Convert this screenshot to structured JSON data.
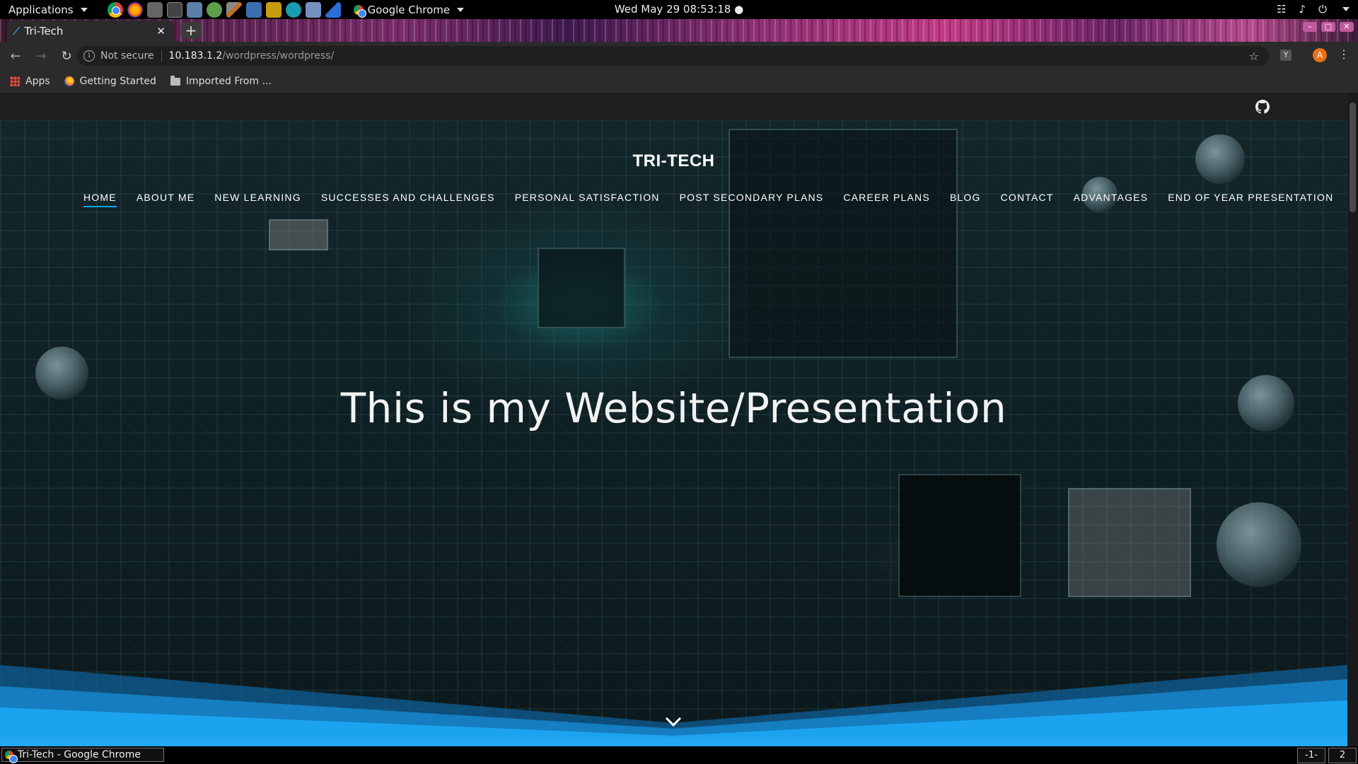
{
  "panel": {
    "applications_label": "Applications",
    "active_app": "Google Chrome",
    "clock": "Wed May 29  08:53:18 ●"
  },
  "tab": {
    "title": "Tri-Tech",
    "close": "✕",
    "new_tab": "+"
  },
  "toolbar": {
    "back": "←",
    "forward": "→",
    "reload": "↻",
    "not_secure": "Not secure",
    "url_host": "10.183.1.2",
    "url_path": "/wordpress/wordpress/",
    "star": "☆",
    "ext_label": "Y",
    "avatar_letter": "A",
    "menu": "⋮"
  },
  "bookmarks": [
    {
      "label": "Apps",
      "icon": "apps-grid-icon"
    },
    {
      "label": "Getting Started",
      "icon": "firefox-icon"
    },
    {
      "label": "Imported From ...",
      "icon": "folder-icon"
    }
  ],
  "site": {
    "title": "TRI-TECH",
    "nav": [
      {
        "label": "HOME",
        "active": true
      },
      {
        "label": "ABOUT ME",
        "active": false
      },
      {
        "label": "NEW LEARNING",
        "active": false
      },
      {
        "label": "SUCCESSES AND CHALLENGES",
        "active": false
      },
      {
        "label": "PERSONAL SATISFACTION",
        "active": false
      },
      {
        "label": "POST SECONDARY PLANS",
        "active": false
      },
      {
        "label": "CAREER PLANS",
        "active": false
      },
      {
        "label": "BLOG",
        "active": false
      },
      {
        "label": "CONTACT",
        "active": false
      },
      {
        "label": "ADVANTAGES",
        "active": false
      },
      {
        "label": "END OF YEAR PRESENTATION",
        "active": false
      }
    ],
    "hero_heading": "This is my Website/Presentation",
    "accent": "#0ea3ff"
  },
  "taskbar": {
    "task_label": "Tri-Tech - Google Chrome",
    "workspaces": [
      "-1-",
      "2"
    ]
  }
}
